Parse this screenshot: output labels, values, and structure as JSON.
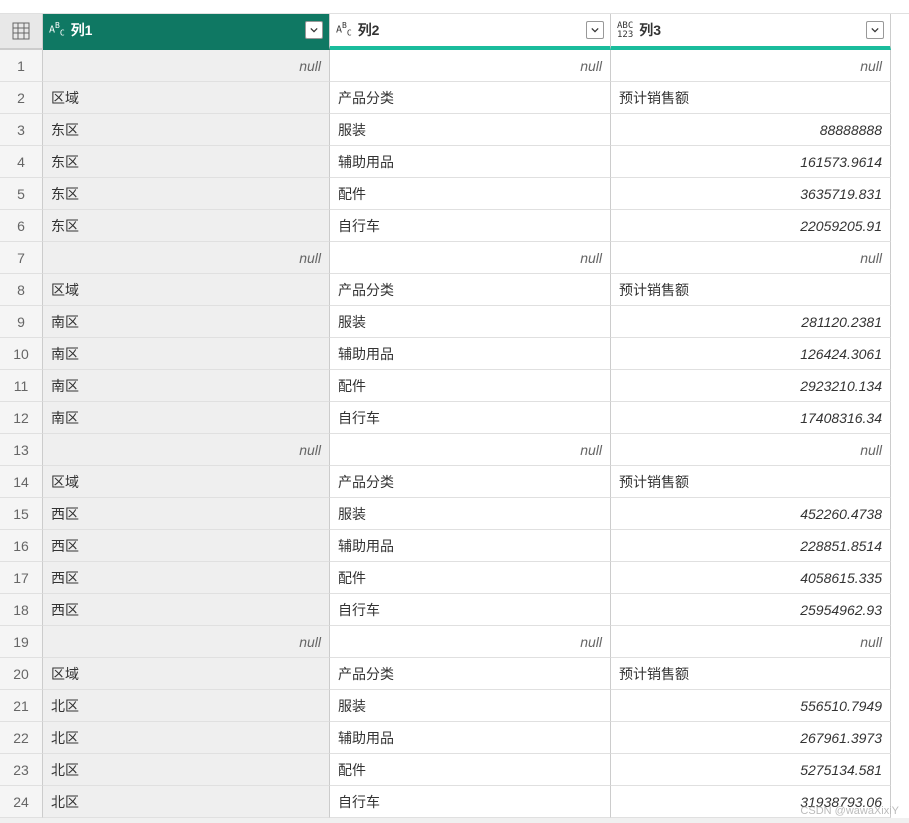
{
  "columns": [
    {
      "name": "列1",
      "typeIcon": "ABC",
      "selected": true
    },
    {
      "name": "列2",
      "typeIcon": "ABC",
      "selected": false
    },
    {
      "name": "列3",
      "typeIcon": "ABC123",
      "selected": false
    }
  ],
  "nullLabel": "null",
  "rows": [
    {
      "n": 1,
      "c1": null,
      "c2": null,
      "c3": null
    },
    {
      "n": 2,
      "c1": "区域",
      "c2": "产品分类",
      "c3": "预计销售额"
    },
    {
      "n": 3,
      "c1": "东区",
      "c2": "服装",
      "c3": "88888888"
    },
    {
      "n": 4,
      "c1": "东区",
      "c2": "辅助用品",
      "c3": "161573.9614"
    },
    {
      "n": 5,
      "c1": "东区",
      "c2": "配件",
      "c3": "3635719.831"
    },
    {
      "n": 6,
      "c1": "东区",
      "c2": "自行车",
      "c3": "22059205.91"
    },
    {
      "n": 7,
      "c1": null,
      "c2": null,
      "c3": null
    },
    {
      "n": 8,
      "c1": "区域",
      "c2": "产品分类",
      "c3": "预计销售额"
    },
    {
      "n": 9,
      "c1": "南区",
      "c2": "服装",
      "c3": "281120.2381"
    },
    {
      "n": 10,
      "c1": "南区",
      "c2": "辅助用品",
      "c3": "126424.3061"
    },
    {
      "n": 11,
      "c1": "南区",
      "c2": "配件",
      "c3": "2923210.134"
    },
    {
      "n": 12,
      "c1": "南区",
      "c2": "自行车",
      "c3": "17408316.34"
    },
    {
      "n": 13,
      "c1": null,
      "c2": null,
      "c3": null
    },
    {
      "n": 14,
      "c1": "区域",
      "c2": "产品分类",
      "c3": "预计销售额"
    },
    {
      "n": 15,
      "c1": "西区",
      "c2": "服装",
      "c3": "452260.4738"
    },
    {
      "n": 16,
      "c1": "西区",
      "c2": "辅助用品",
      "c3": "228851.8514"
    },
    {
      "n": 17,
      "c1": "西区",
      "c2": "配件",
      "c3": "4058615.335"
    },
    {
      "n": 18,
      "c1": "西区",
      "c2": "自行车",
      "c3": "25954962.93"
    },
    {
      "n": 19,
      "c1": null,
      "c2": null,
      "c3": null
    },
    {
      "n": 20,
      "c1": "区域",
      "c2": "产品分类",
      "c3": "预计销售额"
    },
    {
      "n": 21,
      "c1": "北区",
      "c2": "服装",
      "c3": "556510.7949"
    },
    {
      "n": 22,
      "c1": "北区",
      "c2": "辅助用品",
      "c3": "267961.3973"
    },
    {
      "n": 23,
      "c1": "北区",
      "c2": "配件",
      "c3": "5275134.581"
    },
    {
      "n": 24,
      "c1": "北区",
      "c2": "自行车",
      "c3": "31938793.06"
    }
  ],
  "watermark": "CSDN @wawaXixiY"
}
